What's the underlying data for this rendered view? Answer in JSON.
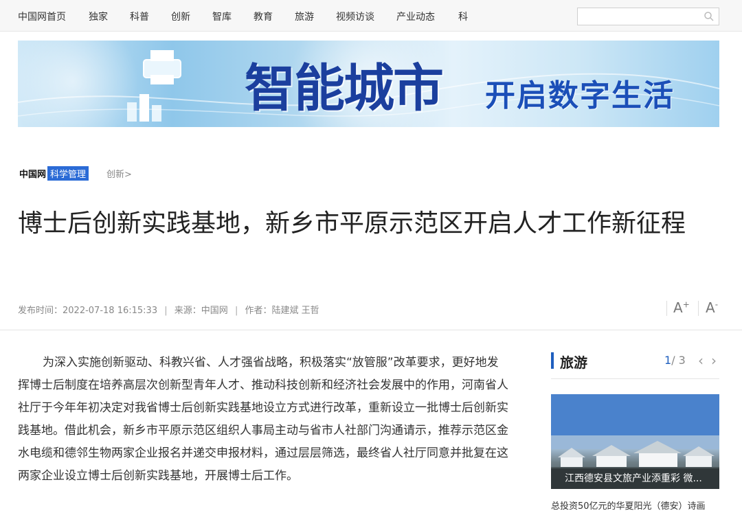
{
  "topnav": {
    "items": [
      "中国网首页",
      "独家",
      "科普",
      "创新",
      "智库",
      "教育",
      "旅游",
      "视频访谈",
      "产业动态",
      "科"
    ],
    "search_placeholder": ""
  },
  "banner": {
    "title_big": "智能城市",
    "title_sub": "开启数字生活"
  },
  "breadcrumb": {
    "logo": "中国网",
    "section": "科学管理",
    "sub": "创新>"
  },
  "article": {
    "title": "博士后创新实践基地，新乡市平原示范区开启人才工作新征程",
    "publish_label": "发布时间：",
    "publish_time": "2022-07-18 16:15:33",
    "source_label": "来源：",
    "source": "中国网",
    "author_label": "作者：",
    "author": "陆建斌 王哲",
    "font_increase": "A",
    "font_decrease": "A",
    "body": "为深入实施创新驱动、科教兴省、人才强省战略，积极落实“放管服”改革要求，更好地发挥博士后制度在培养高层次创新型青年人才、推动科技创新和经济社会发展中的作用，河南省人社厅于今年年初决定对我省博士后创新实践基地设立方式进行改革，重新设立一批博士后创新实践基地。借此机会，新乡市平原示范区组织人事局主动与省市人社部门沟通请示，推荐示范区金水电缆和德邻生物两家企业报名并递交申报材料，通过层层筛选，最终省人社厅同意并批复在这两家企业设立博士后创新实践基地，开展博士后工作。"
  },
  "sidebar": {
    "label": "旅游",
    "page_current": "1",
    "page_total": "/ 3",
    "prev_arrow": "‹",
    "next_arrow": "›",
    "image_caption": "江西德安县文旅产业添重彩 微...",
    "item_text": "总投资50亿元的华夏阳光（德安）诗画"
  },
  "colors": {
    "accent": "#2b6bd6",
    "sidebar_accent": "#1f5fbf"
  }
}
